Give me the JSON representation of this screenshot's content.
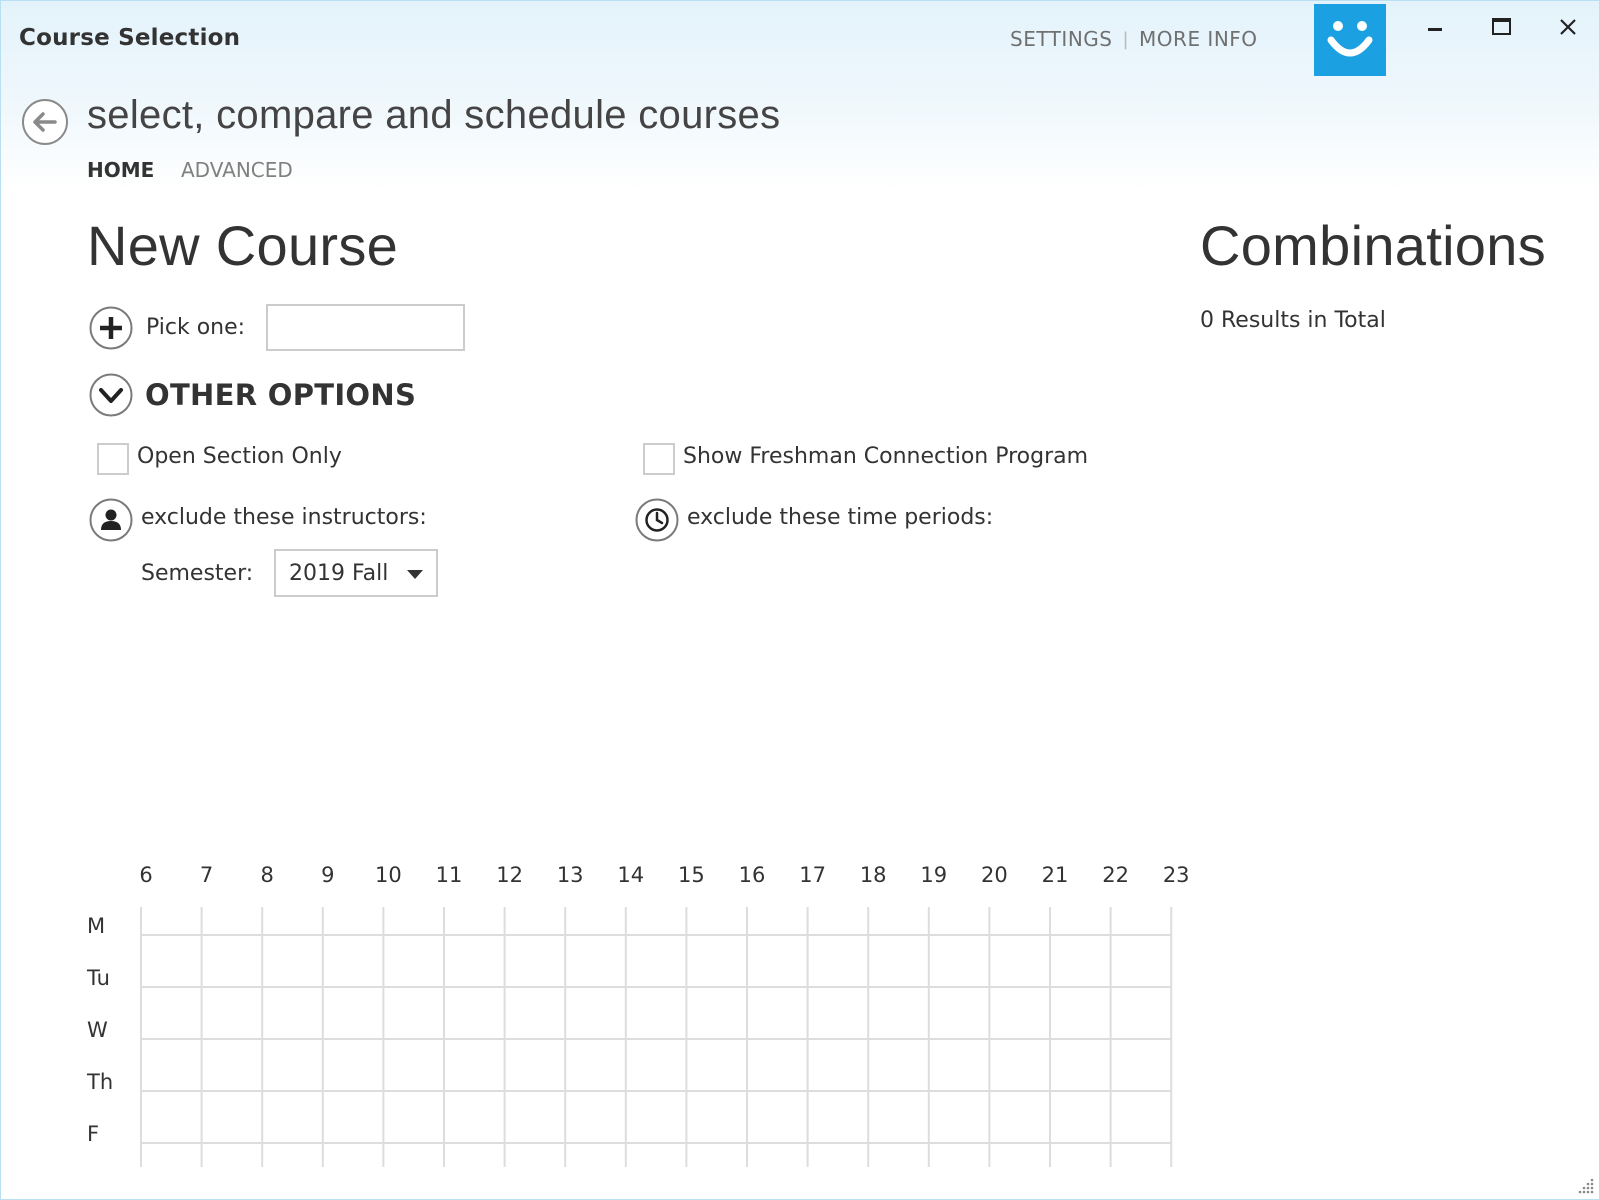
{
  "window": {
    "title": "Course Selection",
    "accent_color": "#1ba1e2",
    "controls": {
      "minimize_icon": "minimize-icon",
      "maximize_icon": "maximize-icon",
      "close_icon": "close-icon"
    }
  },
  "toplinks": {
    "settings": "SETTINGS",
    "separator": "|",
    "more_info": "MORE INFO"
  },
  "header": {
    "back_icon": "back-arrow-icon",
    "subtitle": "select, compare and schedule courses"
  },
  "nav": {
    "tabs": [
      {
        "label": "HOME",
        "active": true
      },
      {
        "label": "ADVANCED",
        "active": false
      }
    ]
  },
  "new_course": {
    "heading": "New Course",
    "pick_label": "Pick one:",
    "pick_value": "",
    "other_options": "OTHER OPTIONS",
    "open_section_only": {
      "label": "Open Section Only",
      "checked": false
    },
    "show_freshman": {
      "label": "Show Freshman Connection Program",
      "checked": false
    },
    "exclude_instructors": "exclude these instructors:",
    "exclude_times": "exclude these time periods:",
    "semester_label": "Semester:",
    "semester_value": "2019 Fall"
  },
  "combinations": {
    "heading": "Combinations",
    "results": "0 Results in Total"
  },
  "schedule": {
    "hours": [
      "6",
      "7",
      "8",
      "9",
      "10",
      "11",
      "12",
      "13",
      "14",
      "15",
      "16",
      "17",
      "18",
      "19",
      "20",
      "21",
      "22",
      "23"
    ],
    "days": [
      "M",
      "Tu",
      "W",
      "Th",
      "F"
    ]
  }
}
